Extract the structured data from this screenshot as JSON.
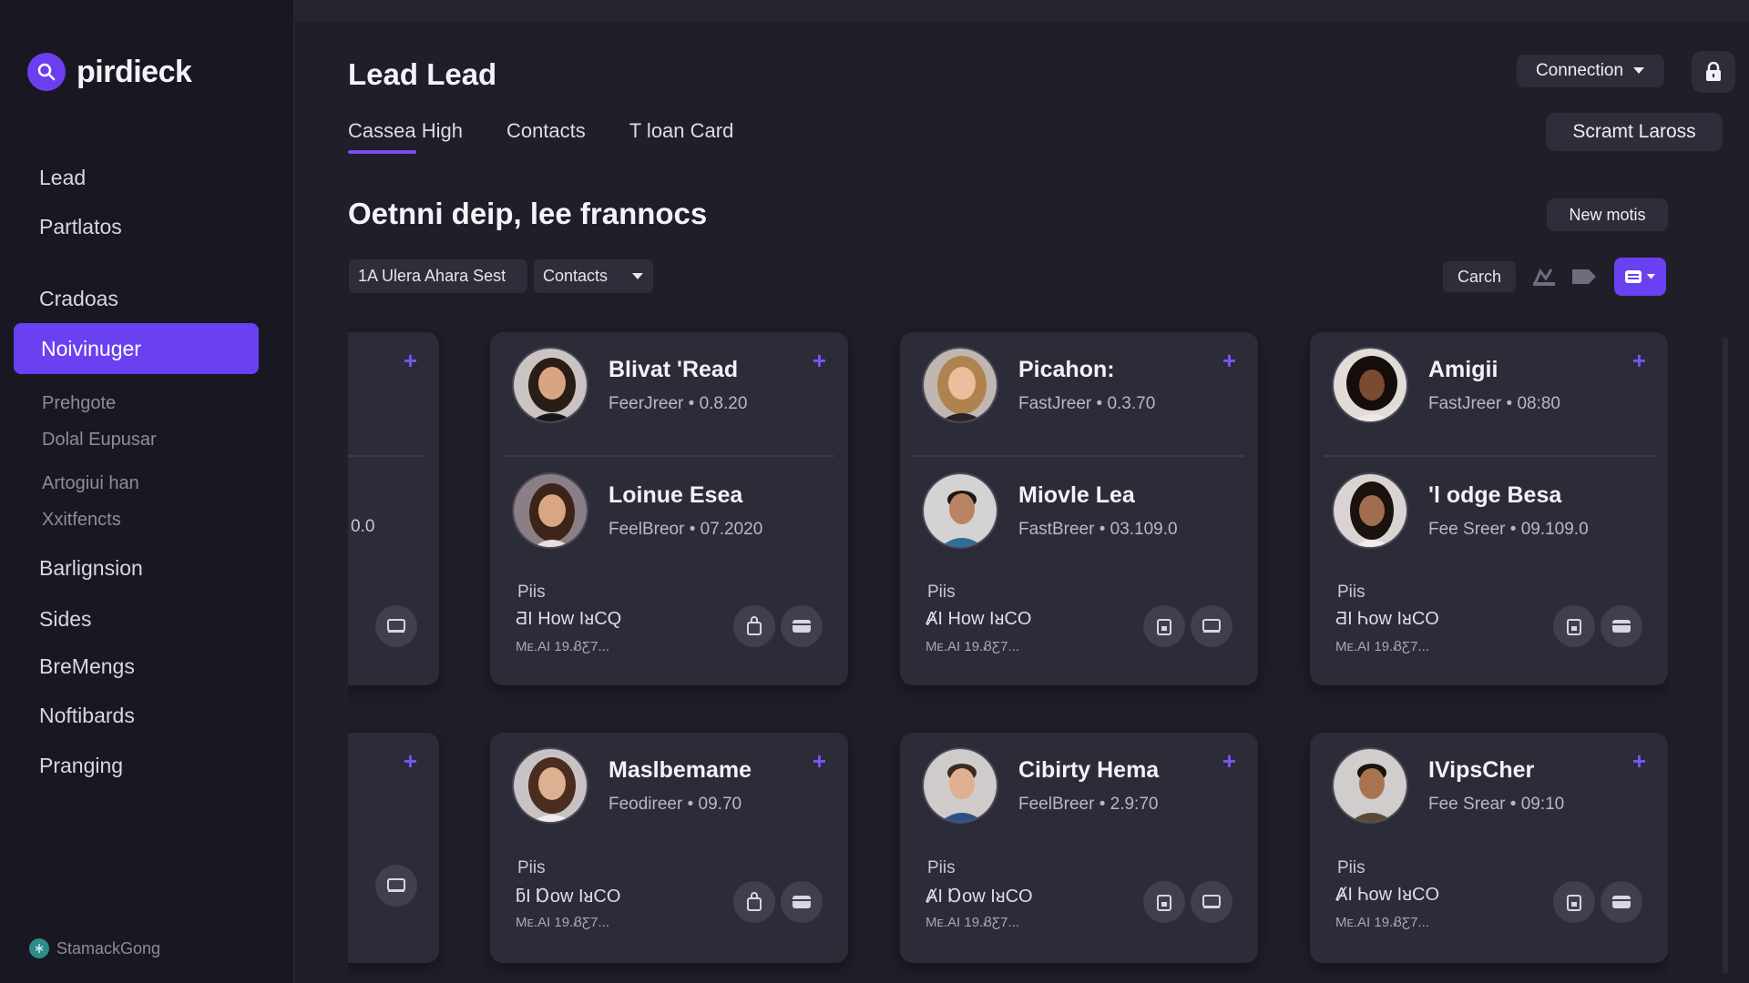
{
  "brand": {
    "name": "pirdieck"
  },
  "sidebar": {
    "items": [
      {
        "label": "Lead"
      },
      {
        "label": "Partlatos"
      },
      {
        "label": "Cradoas"
      },
      {
        "label": "Noivinuger"
      },
      {
        "label": "Prehgote"
      },
      {
        "label": "Dolal Eupusar"
      },
      {
        "label": "Artogiui han"
      },
      {
        "label": "Xxitfencts"
      },
      {
        "label": "Barlignsion"
      },
      {
        "label": "Sides"
      },
      {
        "label": "BreMengs"
      },
      {
        "label": "Noftibards"
      },
      {
        "label": "Pranging"
      }
    ],
    "footer": "StamackGong"
  },
  "header": {
    "title": "Lead Lead",
    "tabs": [
      {
        "label": "Cassea High"
      },
      {
        "label": "Contacts"
      },
      {
        "label": "T loan Card"
      }
    ],
    "connection_label": "Connection",
    "scrant_label": "Scramt Laross"
  },
  "section": {
    "title": "Oetnni deip, lee frannocs",
    "new_button": "New motis"
  },
  "filters": {
    "first": "1A Ulera Ahara Sest",
    "second": "Contacts",
    "search": "Carch"
  },
  "cards": [
    {
      "people": [
        {
          "name": "Blivat 'Read",
          "meta": "FeerJreer  •  0.8.20"
        },
        {
          "name": "Loinue Esea",
          "meta": "FeelBreor  •  07.2020"
        }
      ],
      "footer_label": "Piis",
      "footer_sub": "ƋI How IᴚCQ",
      "footer_tiny": "Mᴇ.AI 19.ᏰƸ7..."
    },
    {
      "people": [
        {
          "name": "Picahon:",
          "meta": "FastJreer  •  0.3.70"
        },
        {
          "name": "Miovle Lea",
          "meta": "FastBreer  •  03.109.0"
        }
      ],
      "footer_label": "Piis",
      "footer_sub": "ȺI How IᴚCO",
      "footer_tiny": "Mᴇ.AI 19.ᏰƸ7..."
    },
    {
      "people": [
        {
          "name": "Amigii",
          "meta": "FastJreer  •  08:80"
        },
        {
          "name": "'l odge Besa",
          "meta": "Fee Sreer  •  09.109.0"
        }
      ],
      "footer_label": "Piis",
      "footer_sub": "ƋI Ꮒow IᴚCO",
      "footer_tiny": "Mᴇ.AI 19.ᏰƸ7..."
    },
    {
      "people": [
        {
          "name": "Maslbemame",
          "meta": "Feodireer  •  09.70"
        }
      ],
      "footer_label": "Piis",
      "footer_sub": "ƃI Ɒow IᴚCO",
      "footer_tiny": "Mᴇ.AI 19.ᏰƸ7..."
    },
    {
      "people": [
        {
          "name": "Cibirty Hema",
          "meta": "FeelBreer  •  2.9:70"
        }
      ],
      "footer_label": "Piis",
      "footer_sub": "ȺI Ɒow IᴚCO",
      "footer_tiny": "Mᴇ.AI 19.ᏰƸ7..."
    },
    {
      "people": [
        {
          "name": "IVipsCher",
          "meta": "Fee Srear  •  09:10"
        }
      ],
      "footer_label": "Piis",
      "footer_sub": "ȺI Ꮒow IᴚCO",
      "footer_tiny": "Mᴇ.AI 19.ᏰƸ7..."
    }
  ],
  "partial_card": {
    "value": "0.0"
  },
  "colors": {
    "accent": "#6a40f0",
    "background": "#1f1e29",
    "sidebar": "#191822",
    "card": "#2c2b38"
  },
  "icons": [
    "search-icon",
    "lock-icon",
    "chevron-down-icon",
    "plus-icon",
    "bag-icon",
    "card-icon",
    "chart-icon",
    "tag-icon",
    "grid-icon"
  ]
}
